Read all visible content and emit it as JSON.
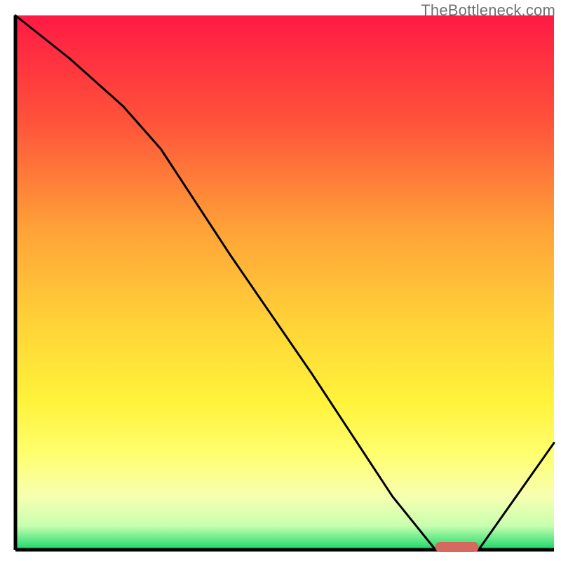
{
  "watermark": "TheBottleneck.com",
  "chart_data": {
    "type": "line",
    "title": "",
    "xlabel": "",
    "ylabel": "",
    "xlim": [
      0,
      100
    ],
    "ylim": [
      0,
      100
    ],
    "x": [
      0,
      10,
      20,
      27,
      40,
      55,
      70,
      78,
      82,
      86,
      100
    ],
    "values": [
      100,
      92,
      83,
      75,
      55,
      33,
      10,
      0,
      0,
      0,
      20
    ],
    "marker": {
      "x_start": 78,
      "x_end": 86,
      "color": "#d6695f"
    },
    "gradient_stops": [
      {
        "offset": 0.0,
        "color": "#ff1a44"
      },
      {
        "offset": 0.2,
        "color": "#ff533a"
      },
      {
        "offset": 0.4,
        "color": "#ffa238"
      },
      {
        "offset": 0.58,
        "color": "#ffd438"
      },
      {
        "offset": 0.72,
        "color": "#fff23a"
      },
      {
        "offset": 0.82,
        "color": "#ffff6e"
      },
      {
        "offset": 0.9,
        "color": "#f7ffb0"
      },
      {
        "offset": 0.955,
        "color": "#c8ffb0"
      },
      {
        "offset": 0.99,
        "color": "#3fe07a"
      },
      {
        "offset": 1.0,
        "color": "#18d262"
      }
    ],
    "axis": {
      "stroke": "#000000",
      "width": 5
    },
    "line": {
      "stroke": "#000000",
      "width": 3
    }
  }
}
